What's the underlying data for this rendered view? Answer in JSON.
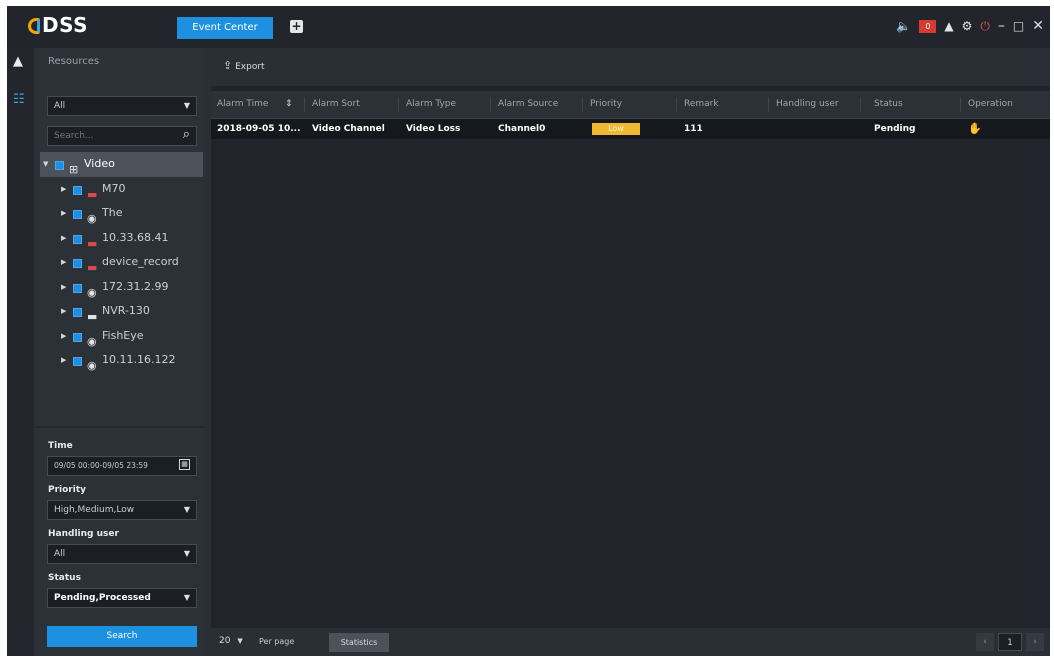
{
  "app": {
    "name": "DSS"
  },
  "titlebar": {
    "tab": "Event Center",
    "alarm_count": "0",
    "icons": [
      "add-tab-icon",
      "speaker-icon",
      "user-icon",
      "gear-icon",
      "power-icon",
      "minimize-icon",
      "maximize-icon",
      "close-icon"
    ]
  },
  "rail": {
    "icons": [
      "alarm-icon",
      "resource-list-icon"
    ]
  },
  "sidebar": {
    "title": "Resources",
    "filter_select": "All",
    "search_placeholder": "Search...",
    "tree": [
      {
        "label": "Video",
        "icon": "video-group-icon",
        "level": 0,
        "expanded": true,
        "selected": true
      },
      {
        "label": "M70",
        "icon": "nvr-device-icon",
        "level": 1,
        "status": "offline"
      },
      {
        "label": "The",
        "icon": "camera-icon",
        "level": 1
      },
      {
        "label": "10.33.68.41",
        "icon": "nvr-device-icon",
        "level": 1,
        "status": "offline"
      },
      {
        "label": "device_record",
        "icon": "nvr-device-icon",
        "level": 1,
        "status": "offline"
      },
      {
        "label": "172.31.2.99",
        "icon": "camera-icon",
        "level": 1
      },
      {
        "label": "NVR-130",
        "icon": "nvr-device-icon",
        "level": 1
      },
      {
        "label": "FishEye",
        "icon": "camera-icon",
        "level": 1
      },
      {
        "label": "10.11.16.122",
        "icon": "camera-icon",
        "level": 1
      }
    ],
    "filters": {
      "time_label": "Time",
      "time_value": "09/05 00:00-09/05 23:59",
      "priority_label": "Priority",
      "priority_value": "High,Medium,Low",
      "handling_label": "Handling user",
      "handling_value": "All",
      "status_label": "Status",
      "status_value": "Pending,Processed"
    },
    "search_button": "Search"
  },
  "main": {
    "export_label": "Export",
    "columns": [
      "Alarm Time",
      "Alarm Sort",
      "Alarm Type",
      "Alarm Source",
      "Priority",
      "Remark",
      "Handling user",
      "Status",
      "Operation"
    ],
    "rows": [
      {
        "alarm_time": "2018-09-05 10...",
        "alarm_sort": "Video Channel",
        "alarm_type": "Video Loss",
        "alarm_source": "Channel0",
        "priority": "Low",
        "remark": "111",
        "handling_user": "",
        "status": "Pending",
        "operation_icon": "hand-claim-icon"
      }
    ],
    "footer": {
      "per_page_value": "20",
      "per_page_label": "Per page",
      "statistics_button": "Statistics",
      "page": "1"
    }
  },
  "colors": {
    "accent": "#1e90e0",
    "priority_low": "#f2b833",
    "alarm_badge": "#d53b2f",
    "background": "#2a2f36"
  }
}
